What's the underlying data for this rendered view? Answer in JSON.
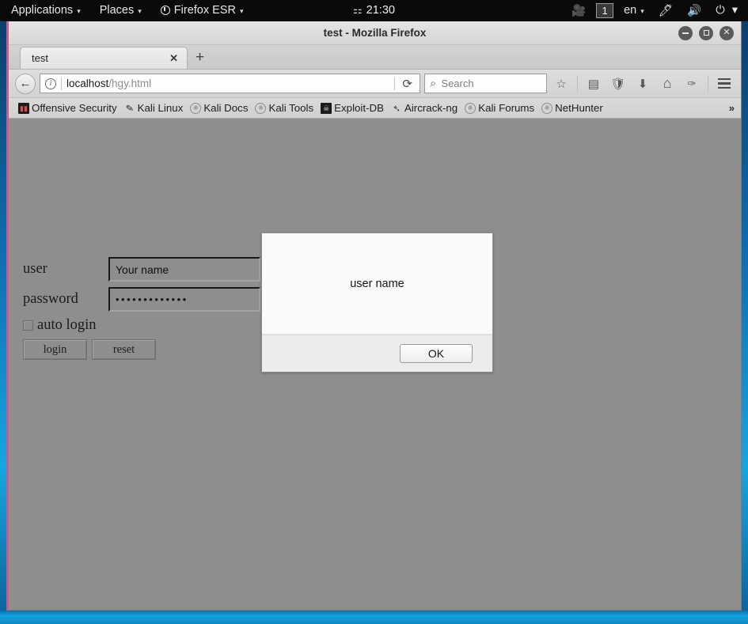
{
  "panel": {
    "applications": "Applications",
    "places": "Places",
    "firefox": "Firefox ESR",
    "clock": "21:30",
    "workspace": "1",
    "language": "en",
    "caret": "▾"
  },
  "window": {
    "title": "test - Mozilla Firefox",
    "minimize": "–",
    "maximize": "□",
    "close": "✕"
  },
  "tabs": {
    "items": [
      {
        "label": "test",
        "close": "✕"
      }
    ],
    "new_tab": "+"
  },
  "navbar": {
    "back": "←",
    "url_host": "localhost",
    "url_path": "/hgy.html",
    "reload": "⟳",
    "search_placeholder": "Search",
    "search_value": "",
    "search_icon": "⌕",
    "bookmark_star": "☆",
    "library": "▤",
    "pocket": "🛡",
    "downloads": "⬇",
    "home": "⌂",
    "extension": "✑"
  },
  "bookmarks": {
    "items": [
      {
        "label": "Offensive Security",
        "icon": "dragon"
      },
      {
        "label": "Kali Linux",
        "icon": "wrench"
      },
      {
        "label": "Kali Docs",
        "icon": "globe"
      },
      {
        "label": "Kali Tools",
        "icon": "globe"
      },
      {
        "label": "Exploit-DB",
        "icon": "exploit"
      },
      {
        "label": "Aircrack-ng",
        "icon": "feather"
      },
      {
        "label": "Kali Forums",
        "icon": "globe"
      },
      {
        "label": "NetHunter",
        "icon": "globe"
      }
    ],
    "overflow": "»"
  },
  "form": {
    "user_label": "user",
    "user_value": "Your name",
    "password_label": "password",
    "password_value": "•••••••••••••",
    "autologin_label": "auto login",
    "login_button": "login",
    "reset_button": "reset"
  },
  "dialog": {
    "message": "user name",
    "ok_button": "OK"
  },
  "colors": {
    "panel_bg": "#0a0a0a",
    "page_bg": "#8e8e8c",
    "window_border_accent": "#c45d8d",
    "desktop_blue": "#17a2dd",
    "dialog_bg": "#fafafa"
  }
}
